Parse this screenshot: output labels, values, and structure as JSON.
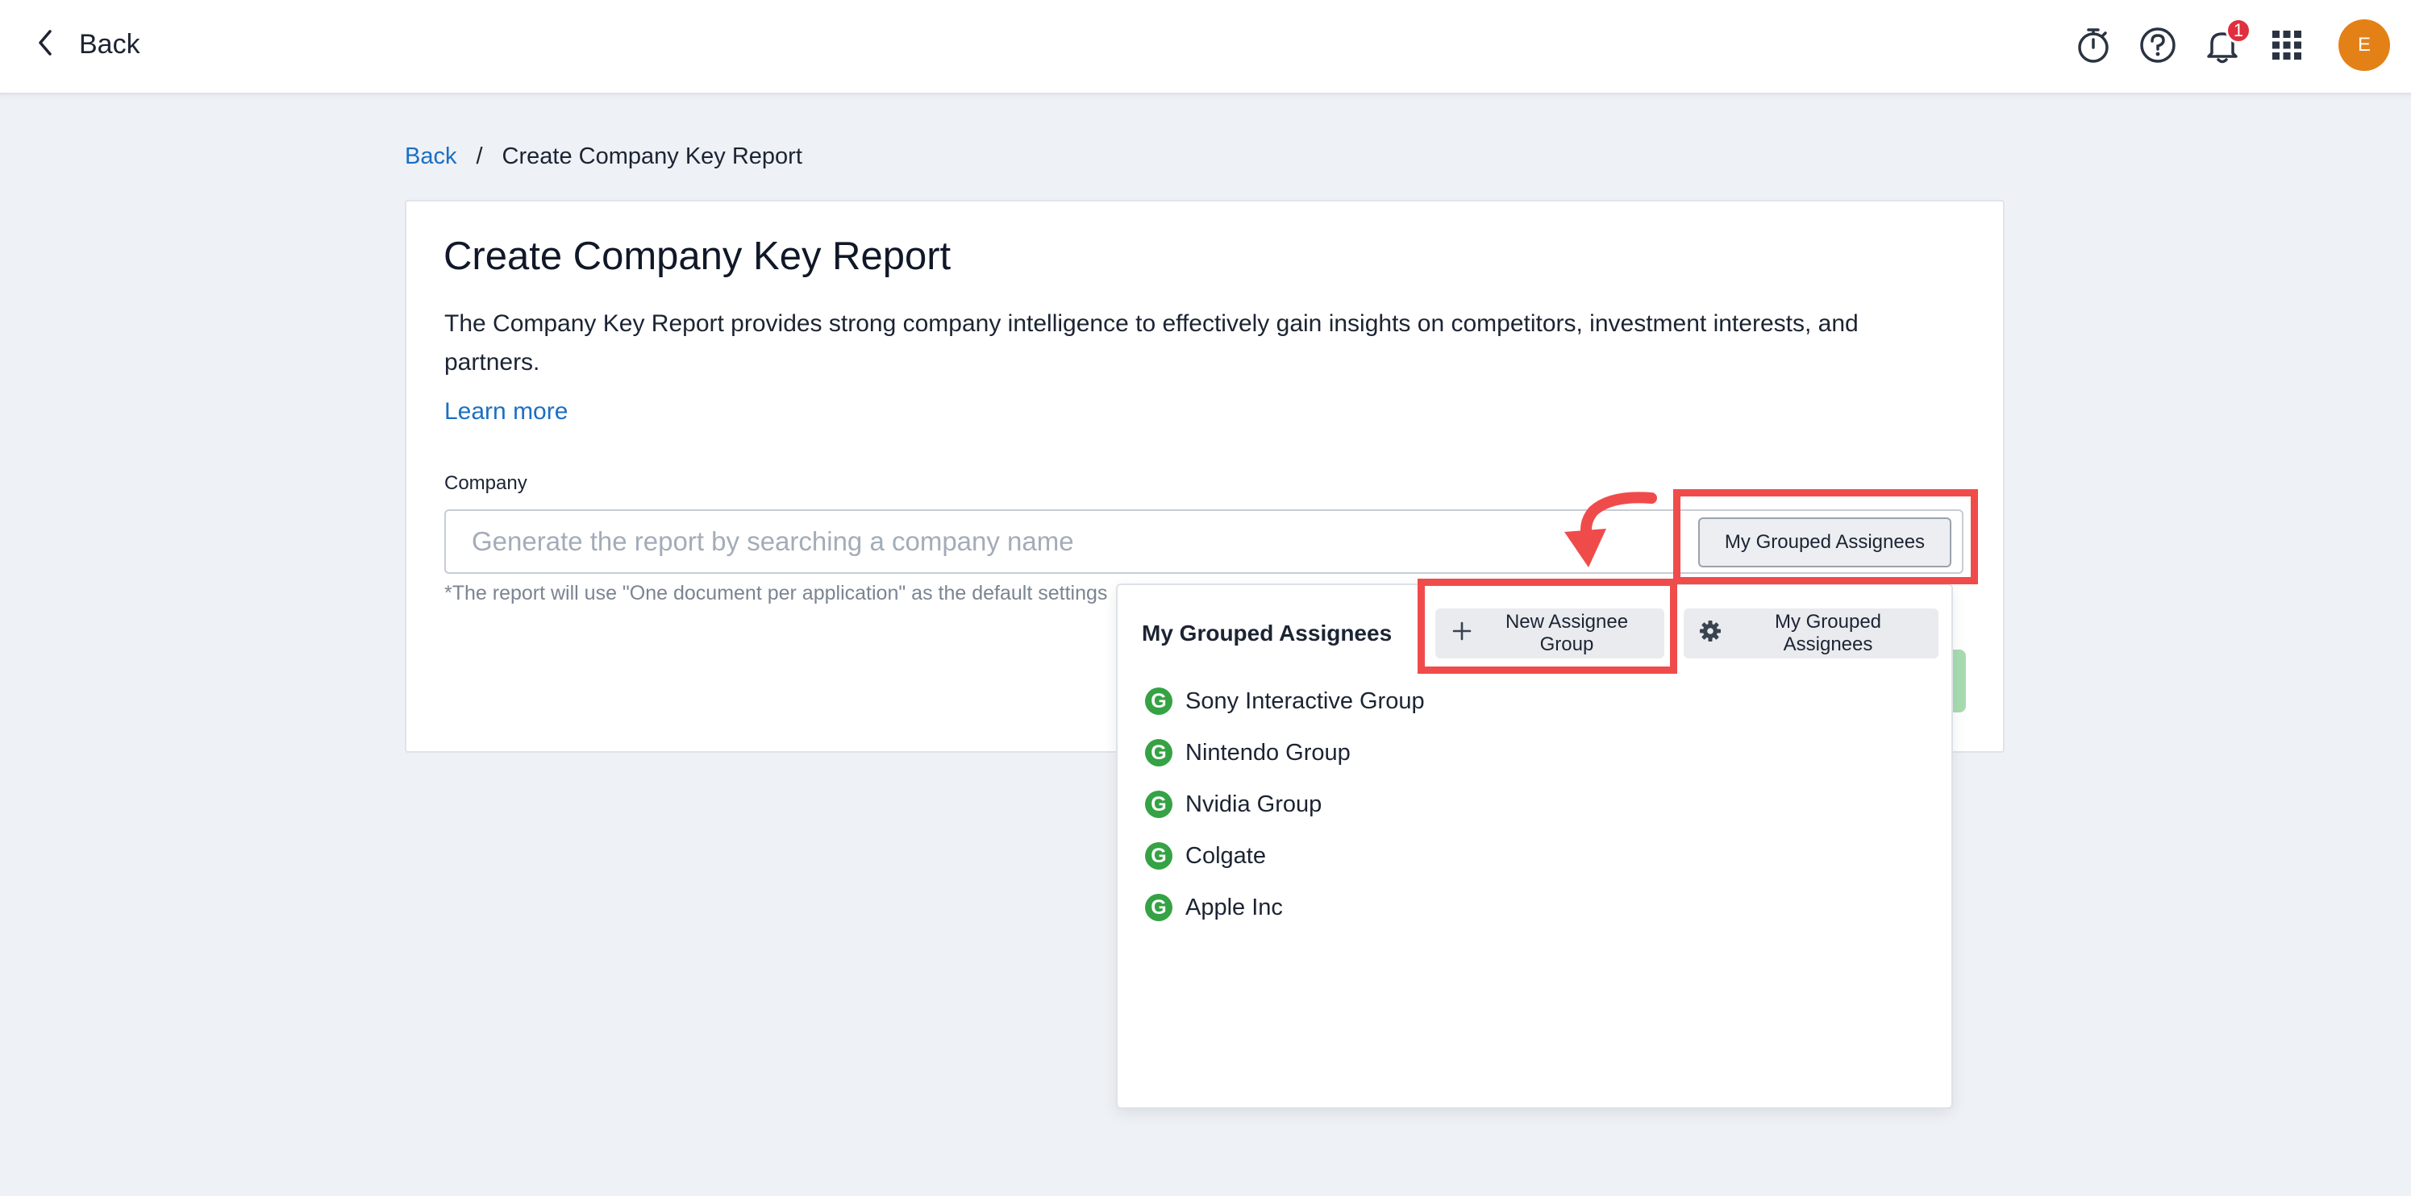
{
  "topbar": {
    "back_label": "Back",
    "notification_count": "1",
    "avatar_initial": "E",
    "icons": [
      "timer-icon",
      "help-icon",
      "bell-icon",
      "apps-grid-icon"
    ]
  },
  "breadcrumb": {
    "back": "Back",
    "separator": "/",
    "current": "Create Company Key Report"
  },
  "card": {
    "title": "Create Company Key Report",
    "description": "The Company Key Report provides strong company intelligence to effectively gain insights on competitors, investment interests, and partners.",
    "learn_more": "Learn more",
    "company_label": "Company",
    "company_placeholder": "Generate the report by searching a company name",
    "company_value": "",
    "hint": "*The report will use \"One document per application\" as the default settings"
  },
  "grouped_button_label": "My Grouped Assignees",
  "dropdown": {
    "title": "My Grouped Assignees",
    "new_group_label": "New Assignee Group",
    "manage_label": "My Grouped Assignees",
    "group_icon_letter": "G",
    "groups": [
      {
        "name": "Sony Interactive Group"
      },
      {
        "name": "Nintendo Group"
      },
      {
        "name": "Nvidia Group"
      },
      {
        "name": "Colgate"
      },
      {
        "name": "Apple Inc"
      }
    ]
  },
  "colors": {
    "accent_link": "#1a6fc4",
    "annotation_red": "#f04b4b",
    "group_icon_green": "#35a244",
    "avatar_orange": "#e38117",
    "badge_red": "#e02f3e"
  }
}
